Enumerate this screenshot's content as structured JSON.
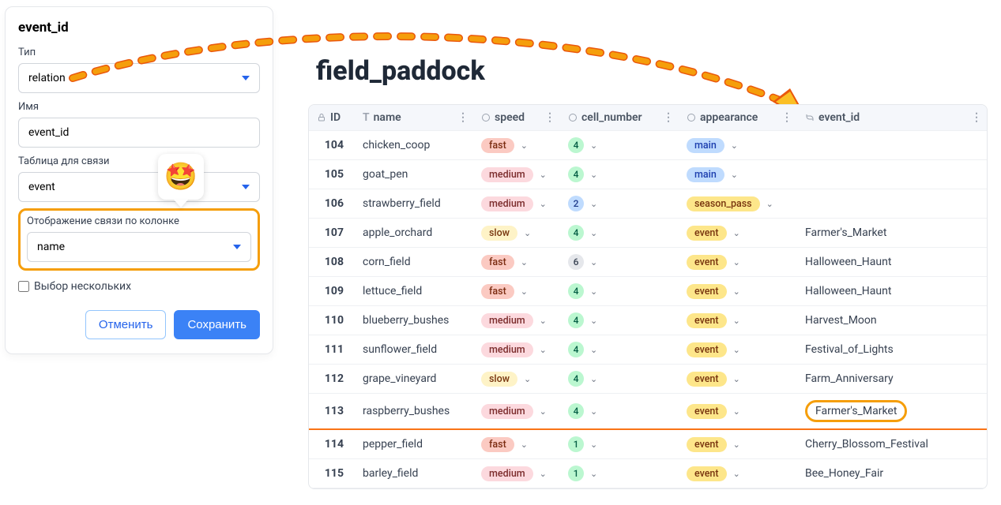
{
  "panel": {
    "title": "event_id",
    "labels": {
      "type": "Тип",
      "name": "Имя",
      "relation_table": "Таблица для связи",
      "display_column": "Отображение связи по колонке",
      "multi_select": "Выбор нескольких"
    },
    "values": {
      "type": "relation",
      "name": "event_id",
      "relation_table": "event",
      "display_column": "name"
    },
    "buttons": {
      "cancel": "Отменить",
      "save": "Сохранить"
    },
    "emoji": "🤩"
  },
  "table": {
    "title": "field_paddock",
    "columns": {
      "id": "ID",
      "name": "name",
      "speed": "speed",
      "cell_number": "cell_number",
      "appearance": "appearance",
      "event_id": "event_id"
    },
    "rows": [
      {
        "id": "104",
        "name": "chicken_coop",
        "speed": "fast",
        "cell": "4",
        "appearance": "main",
        "event": ""
      },
      {
        "id": "105",
        "name": "goat_pen",
        "speed": "medium",
        "cell": "4",
        "appearance": "main",
        "event": ""
      },
      {
        "id": "106",
        "name": "strawberry_field",
        "speed": "medium",
        "cell": "2",
        "appearance": "season_pass",
        "event": ""
      },
      {
        "id": "107",
        "name": "apple_orchard",
        "speed": "slow",
        "cell": "4",
        "appearance": "event",
        "event": "Farmer's_Market"
      },
      {
        "id": "108",
        "name": "corn_field",
        "speed": "fast",
        "cell": "6",
        "appearance": "event",
        "event": "Halloween_Haunt"
      },
      {
        "id": "109",
        "name": "lettuce_field",
        "speed": "fast",
        "cell": "4",
        "appearance": "event",
        "event": "Halloween_Haunt"
      },
      {
        "id": "110",
        "name": "blueberry_bushes",
        "speed": "medium",
        "cell": "4",
        "appearance": "event",
        "event": "Harvest_Moon"
      },
      {
        "id": "111",
        "name": "sunflower_field",
        "speed": "medium",
        "cell": "4",
        "appearance": "event",
        "event": "Festival_of_Lights"
      },
      {
        "id": "112",
        "name": "grape_vineyard",
        "speed": "slow",
        "cell": "4",
        "appearance": "event",
        "event": "Farm_Anniversary"
      },
      {
        "id": "113",
        "name": "raspberry_bushes",
        "speed": "medium",
        "cell": "4",
        "appearance": "event",
        "event": "Farmer's_Market",
        "highlight": true
      },
      {
        "id": "114",
        "name": "pepper_field",
        "speed": "fast",
        "cell": "1",
        "appearance": "event",
        "event": "Cherry_Blossom_Festival"
      },
      {
        "id": "115",
        "name": "barley_field",
        "speed": "medium",
        "cell": "1",
        "appearance": "event",
        "event": "Bee_Honey_Fair"
      }
    ]
  },
  "icons": {
    "chevron": "⌄",
    "menu": "⋮"
  }
}
